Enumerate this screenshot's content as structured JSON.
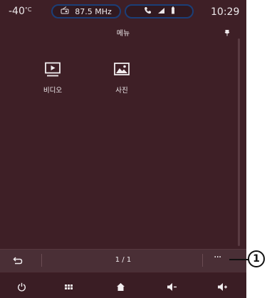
{
  "status": {
    "temperature": "-40",
    "temperature_unit": "°C",
    "radio_frequency": "87.5 MHz",
    "clock": "10:29"
  },
  "header": {
    "title": "메뉴"
  },
  "apps": [
    {
      "label": "비디오",
      "icon": "video-play-icon"
    },
    {
      "label": "사진",
      "icon": "photo-icon"
    }
  ],
  "bottom_bar": {
    "page_indicator": "1 / 1",
    "more_label": "···"
  },
  "callout": {
    "number": "1"
  },
  "colors": {
    "background": "#3e1f26",
    "pill_border": "#1b3f78",
    "bottom_bar": "#4a2f36"
  }
}
